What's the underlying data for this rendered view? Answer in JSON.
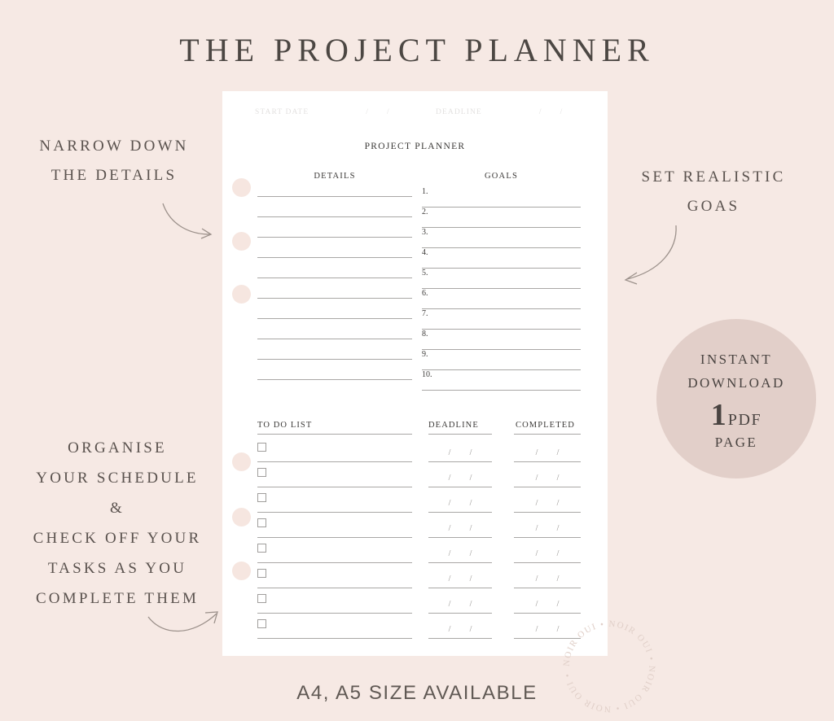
{
  "colors": {
    "background": "#f6e9e4",
    "paper": "#ffffff",
    "badge": "#e2cfc9",
    "hole": "#f6e6e0",
    "rule": "#a9a7a5",
    "ink": "#3c3a38",
    "annotation_ink": "#5a524e",
    "faint_ink": "#e3e1e0"
  },
  "page_title": "THE PROJECT PLANNER",
  "footer_caption": "A4, A5 SIZE AVAILABLE",
  "sheet": {
    "start_date_label": "START DATE",
    "deadline_label": "DEADLINE",
    "date_slash": "/",
    "title": "PROJECT PLANNER",
    "details_heading": "DETAILS",
    "goals_heading": "GOALS",
    "details_line_count": 10,
    "goals": [
      "1.",
      "2.",
      "3.",
      "4.",
      "5.",
      "6.",
      "7.",
      "8.",
      "9.",
      "10."
    ],
    "todo_heading": "TO DO LIST",
    "todo_deadline_heading": "DEADLINE",
    "todo_completed_heading": "COMPLETED",
    "todo_row_count": 8
  },
  "annotations": {
    "details": [
      "NARROW DOWN",
      "THE DETAILS"
    ],
    "goals": [
      "SET REALISTIC",
      "GOAS"
    ],
    "schedule": [
      "ORGANISE",
      "YOUR SCHEDULE",
      "&",
      "CHECK OFF YOUR",
      "TASKS AS YOU",
      "COMPLETE THEM"
    ]
  },
  "badge": {
    "line1": "INSTANT",
    "line2": "DOWNLOAD",
    "count": "1",
    "format": "PDF",
    "unit": "PAGE"
  },
  "watermark": {
    "text": "NOIR OUI • NOIR OUI • NOIR OUI • NOIR OUI • "
  }
}
